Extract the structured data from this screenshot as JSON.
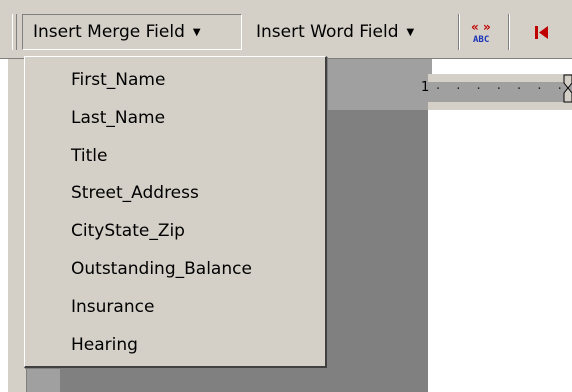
{
  "toolbar": {
    "insert_merge_field_label": "Insert Merge Field",
    "insert_word_field_label": "Insert Word Field",
    "view_merged_data_icon_text": "ABC",
    "first_record_icon": "first-record-icon"
  },
  "ruler": {
    "number": "1",
    "ticks": "· · · · · · ·"
  },
  "merge_fields": [
    "First_Name",
    "Last_Name",
    "Title",
    "Street_Address",
    "CityState_Zip",
    "Outstanding_Balance",
    "Insurance",
    "Hearing"
  ],
  "colors": {
    "toolbar_bg": "#d4d0c8",
    "workspace_gray": "#a0a0a0",
    "page_shadow": "#808080",
    "icon_red": "#c00000",
    "icon_blue": "#1a33b8"
  }
}
